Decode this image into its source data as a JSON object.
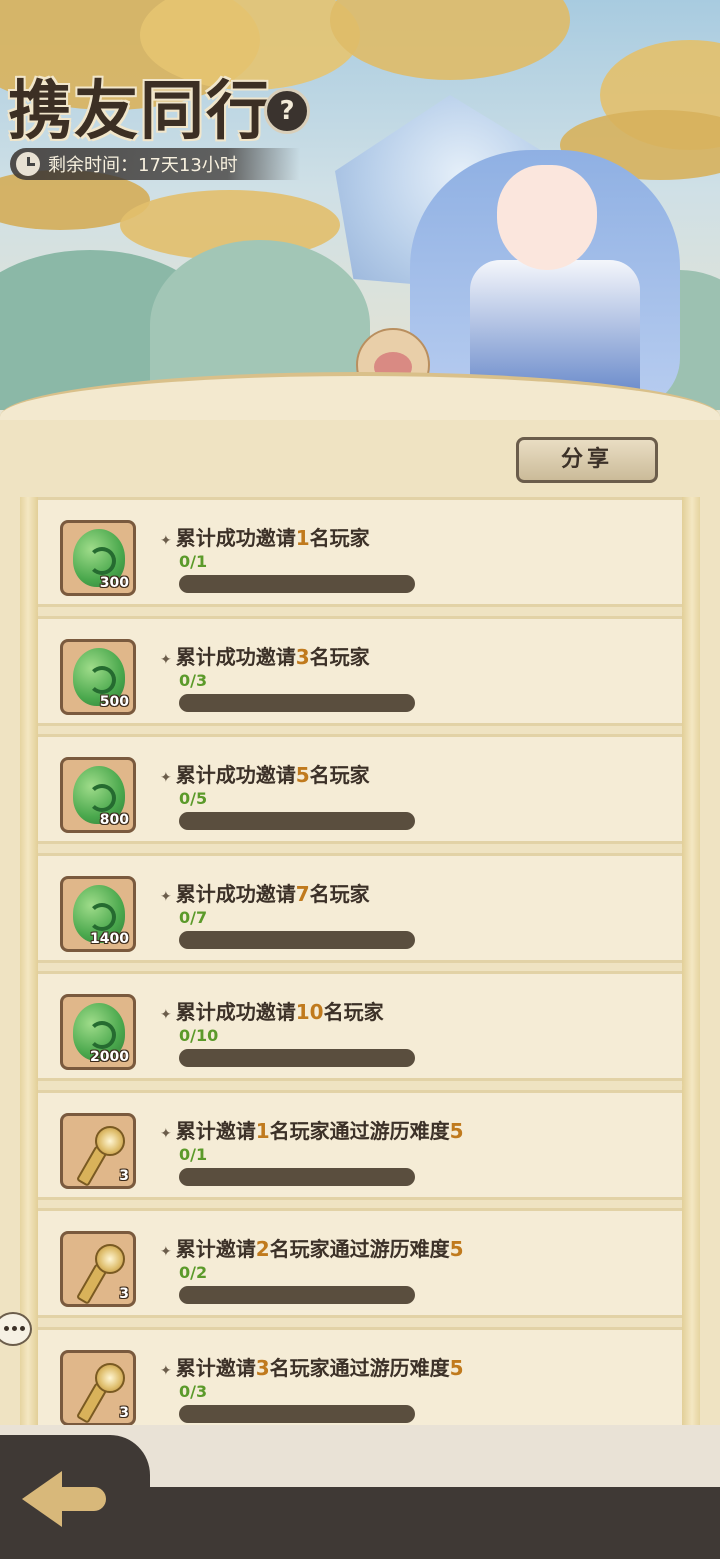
{
  "header": {
    "title": "携友同行",
    "help_icon": "question-icon",
    "timer_label": "剩余时间：",
    "timer_value": "17天13小时"
  },
  "share_button": "分享",
  "tasks": [
    {
      "reward": "jade",
      "count": "300",
      "pre": "累计成功邀请",
      "num": "1",
      "post": "名玩家",
      "progress": "0/1",
      "ratio": 0
    },
    {
      "reward": "jade",
      "count": "500",
      "pre": "累计成功邀请",
      "num": "3",
      "post": "名玩家",
      "progress": "0/3",
      "ratio": 0
    },
    {
      "reward": "jade",
      "count": "800",
      "pre": "累计成功邀请",
      "num": "5",
      "post": "名玩家",
      "progress": "0/5",
      "ratio": 0
    },
    {
      "reward": "jade",
      "count": "1400",
      "pre": "累计成功邀请",
      "num": "7",
      "post": "名玩家",
      "progress": "0/7",
      "ratio": 0
    },
    {
      "reward": "jade",
      "count": "2000",
      "pre": "累计成功邀请",
      "num": "10",
      "post": "名玩家",
      "progress": "0/10",
      "ratio": 0
    },
    {
      "reward": "key",
      "count": "3",
      "pre": "累计邀请",
      "num": "1",
      "post": "名玩家通过游历难度",
      "num2": "5",
      "progress": "0/1",
      "ratio": 0
    },
    {
      "reward": "key",
      "count": "3",
      "pre": "累计邀请",
      "num": "2",
      "post": "名玩家通过游历难度",
      "num2": "5",
      "progress": "0/2",
      "ratio": 0
    },
    {
      "reward": "key",
      "count": "3",
      "pre": "累计邀请",
      "num": "3",
      "post": "名玩家通过游历难度",
      "num2": "5",
      "progress": "0/3",
      "ratio": 0
    }
  ],
  "footer": {
    "back_icon": "back-arrow-icon"
  }
}
